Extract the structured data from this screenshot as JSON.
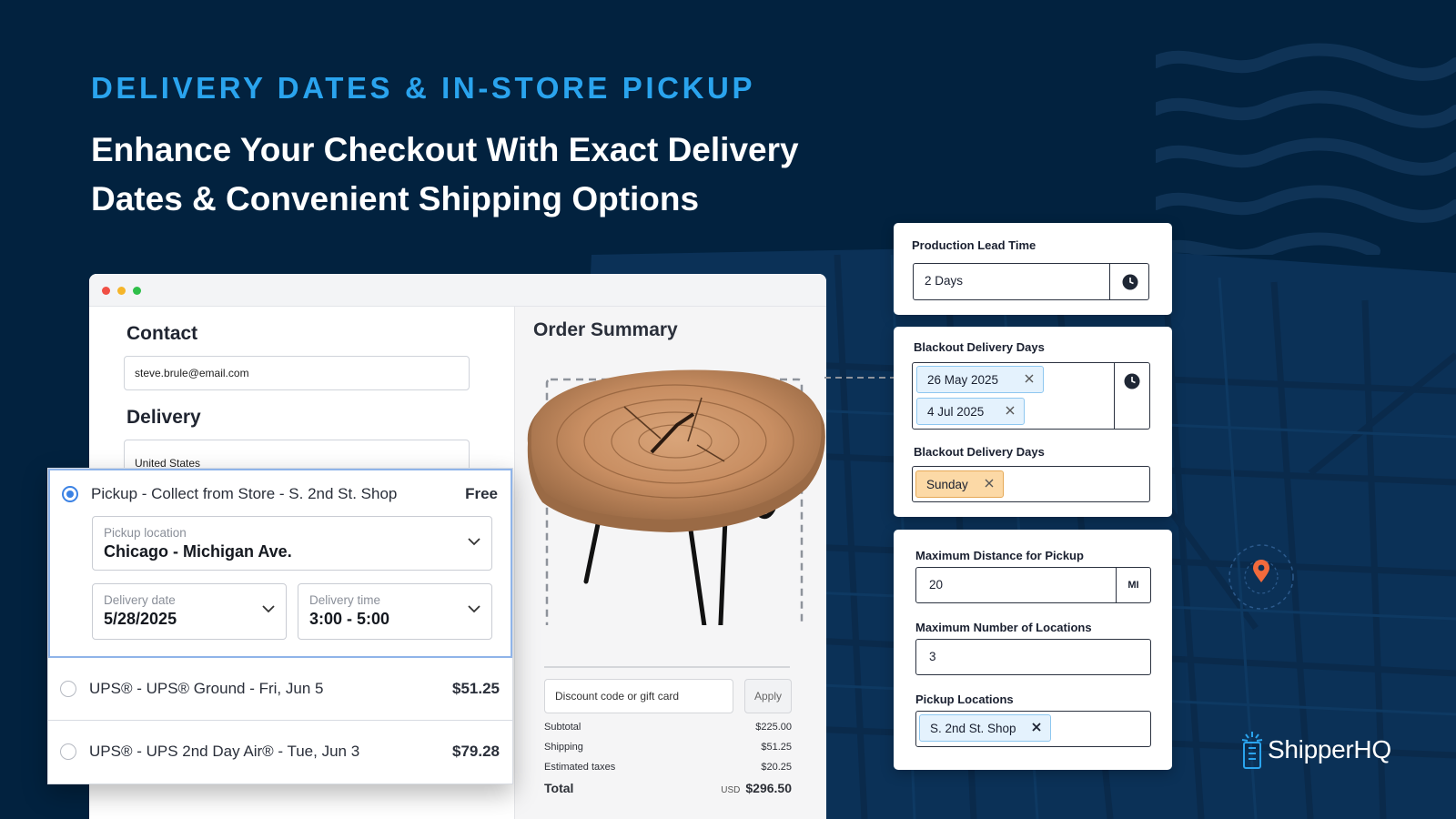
{
  "hero": {
    "eyebrow": "DELIVERY DATES & IN-STORE PICKUP",
    "headline": "Enhance Your Checkout With Exact Delivery Dates & Convenient Shipping Options"
  },
  "checkout": {
    "contact": {
      "title": "Contact",
      "email": "steve.brule@email.com"
    },
    "delivery": {
      "title": "Delivery",
      "country": "United States"
    },
    "order_summary": {
      "title": "Order Summary",
      "discount_placeholder": "Discount code or gift card",
      "apply_label": "Apply",
      "rows": [
        {
          "label": "Subtotal",
          "value": "$225.00"
        },
        {
          "label": "Shipping",
          "value": "$51.25"
        },
        {
          "label": "Estimated taxes",
          "value": "$20.25"
        }
      ],
      "total_label": "Total",
      "total_currency": "USD",
      "total_value": "$296.50"
    }
  },
  "shipping_options": {
    "selected": {
      "label": "Pickup - Collect from Store - S. 2nd St. Shop",
      "price": "Free",
      "pickup_location": {
        "label": "Pickup location",
        "value": "Chicago - Michigan Ave."
      },
      "delivery_date": {
        "label": "Delivery date",
        "value": "5/28/2025"
      },
      "delivery_time": {
        "label": "Delivery time",
        "value": "3:00 - 5:00"
      }
    },
    "others": [
      {
        "label": "UPS® - UPS® Ground - Fri, Jun 5",
        "price": "$51.25"
      },
      {
        "label": "UPS® - UPS 2nd Day Air® - Tue, Jun 3",
        "price": "$79.28"
      }
    ]
  },
  "settings": {
    "lead_time": {
      "label": "Production Lead Time",
      "value": "2 Days"
    },
    "blackout_dates": {
      "label": "Blackout Delivery Days",
      "chips": [
        "26 May 2025",
        "4 Jul 2025"
      ]
    },
    "blackout_days": {
      "label": "Blackout Delivery Days",
      "chips": [
        "Sunday"
      ]
    },
    "pickup": {
      "max_distance_label": "Maximum Distance for Pickup",
      "max_distance_value": "20",
      "max_distance_unit": "MI",
      "max_locations_label": "Maximum Number of Locations",
      "max_locations_value": "3",
      "locations_label": "Pickup Locations",
      "locations_chips": [
        "S. 2nd St. Shop"
      ]
    }
  },
  "brand": {
    "name": "ShipperHQ"
  },
  "colors": {
    "background": "#02223f",
    "accent": "#2aa4ee",
    "radio": "#3b82e4",
    "pin": "#f26a3c"
  }
}
